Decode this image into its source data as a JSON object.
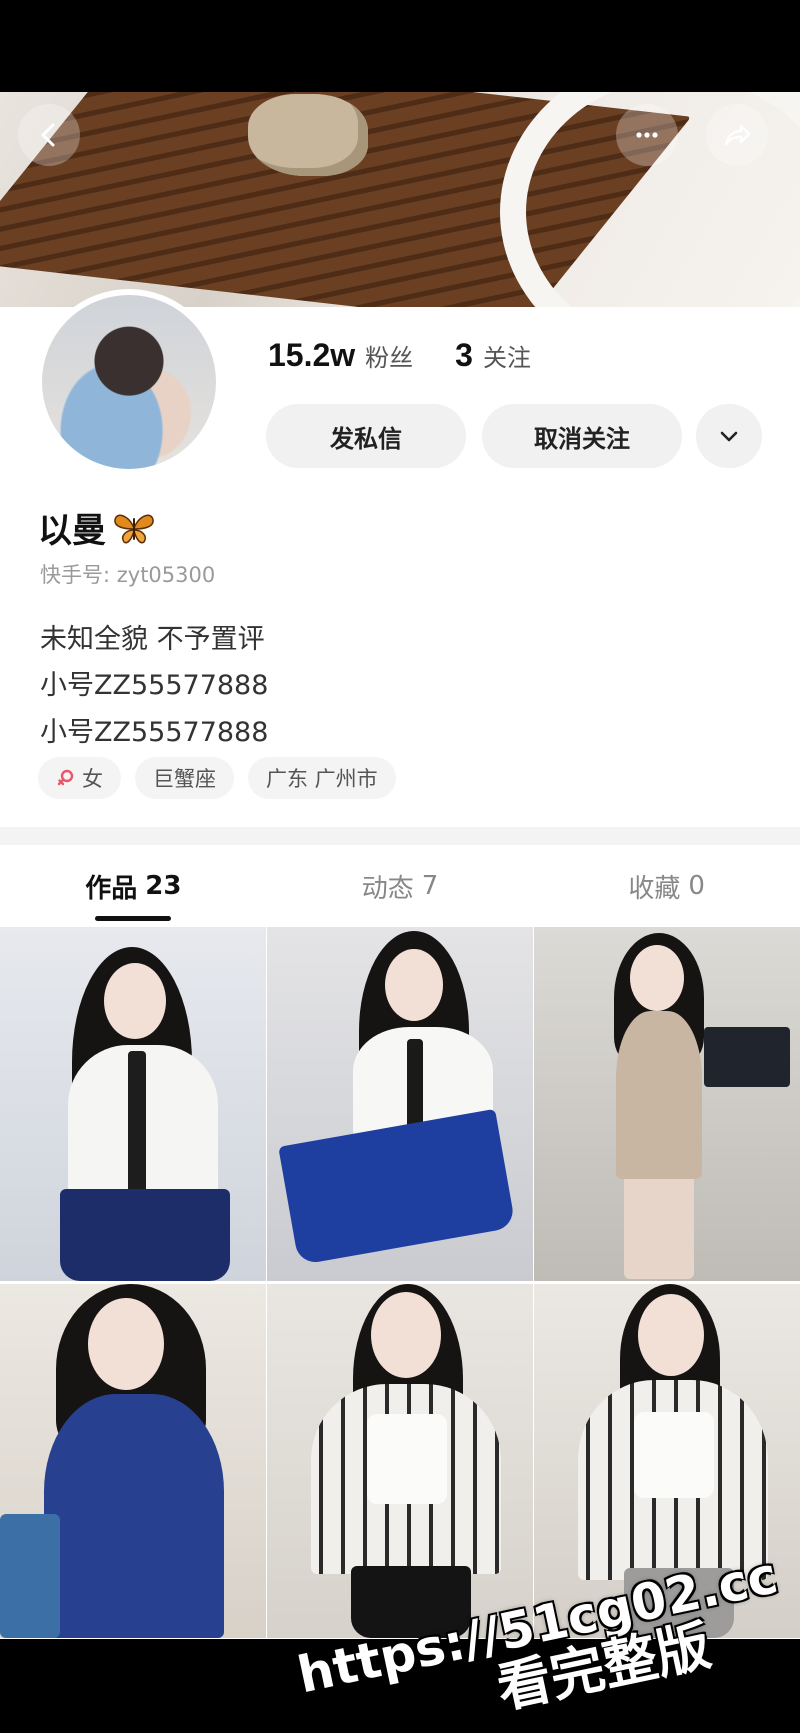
{
  "profile": {
    "name": "以曼",
    "name_emoji": "butterfly-icon",
    "uid": "快手号: zyt05300",
    "followers_count": "15.2w",
    "followers_label": "粉丝",
    "following_count": "3",
    "following_label": "关注",
    "bio": [
      "未知全貌 不予置评",
      "小号ZZ55577888",
      "小号ZZ55577888"
    ],
    "tags": [
      {
        "label": "女",
        "icon": "female-icon"
      },
      {
        "label": "巨蟹座"
      },
      {
        "label": "广东 广州市"
      }
    ]
  },
  "actions": {
    "message_label": "发私信",
    "unfollow_label": "取消关注"
  },
  "tabs": [
    {
      "label": "作品",
      "count": "23",
      "active": true
    },
    {
      "label": "动态",
      "count": "7"
    },
    {
      "label": "收藏",
      "count": "0"
    }
  ],
  "watermark": {
    "line1": "https://51cg02.cc",
    "line2": "看完整版"
  },
  "colors": {
    "page_bg": "#ffffff",
    "button_bg": "#f1f1f1",
    "tag_bg": "#f4f4f4",
    "separator": "#f3f3f3",
    "female_accent": "#e8576a",
    "butterfly": "#e08a1e"
  }
}
